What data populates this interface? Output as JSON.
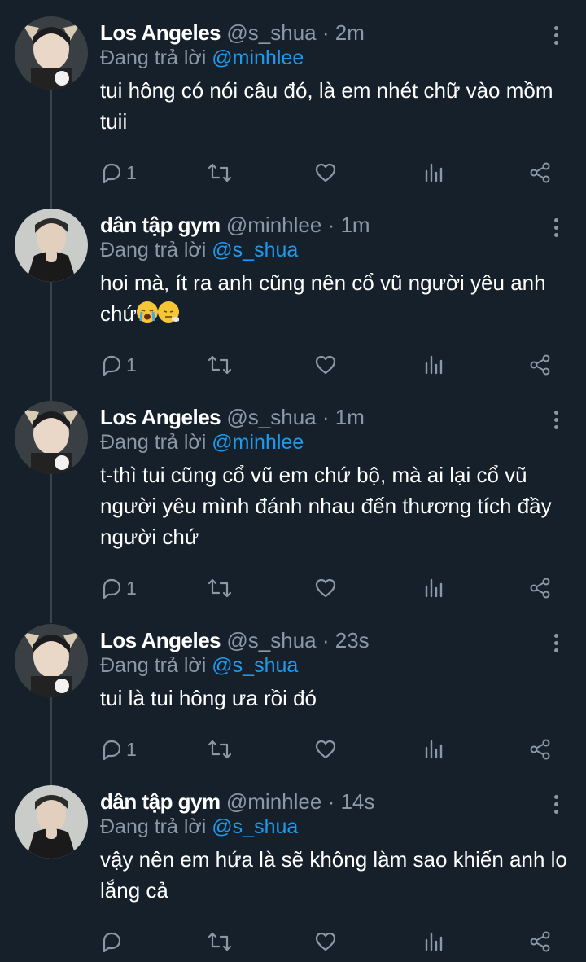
{
  "reply_prefix": "Đang trả lời",
  "colors": {
    "background": "#15202b",
    "secondary_text": "#8b98a5",
    "mention": "#1d9bf0",
    "thread_line": "#38444d"
  },
  "tweets": [
    {
      "name": "Los Angeles",
      "handle": "@s_shua",
      "dot": "·",
      "time": "2m",
      "reply_to": "@minhlee",
      "text": "tui hông có nói câu đó, là em nhét chữ vào mồm tuii",
      "reply_count": "1"
    },
    {
      "name": "dân tập gym",
      "handle": "@minhlee",
      "dot": "·",
      "time": "1m",
      "reply_to": "@s_shua",
      "text": "hoi mà, ít ra anh cũng nên cổ vũ người yêu anh chứ",
      "emojis": [
        "loudly-crying-face",
        "face-with-steam"
      ],
      "reply_count": "1"
    },
    {
      "name": "Los Angeles",
      "handle": "@s_shua",
      "dot": "·",
      "time": "1m",
      "reply_to": "@minhlee",
      "text": "t-thì tui cũng cổ vũ em chứ bộ, mà ai lại cổ vũ người yêu mình đánh nhau đến thương tích đầy người chứ",
      "reply_count": "1"
    },
    {
      "name": "Los Angeles",
      "handle": "@s_shua",
      "dot": "·",
      "time": "23s",
      "reply_to": "@s_shua",
      "text": "tui là tui hông ưa rồi đó",
      "reply_count": "1"
    },
    {
      "name": "dân tập gym",
      "handle": "@minhlee",
      "dot": "·",
      "time": "14s",
      "reply_to": "@s_shua",
      "text": "vậy nên em hứa là sẽ không làm sao khiến anh lo lắng cả",
      "reply_count": ""
    }
  ],
  "icons": {
    "reply": "reply-icon",
    "retweet": "retweet-icon",
    "like": "heart-icon",
    "views": "views-icon",
    "share": "share-icon",
    "more": "more-options-icon"
  }
}
